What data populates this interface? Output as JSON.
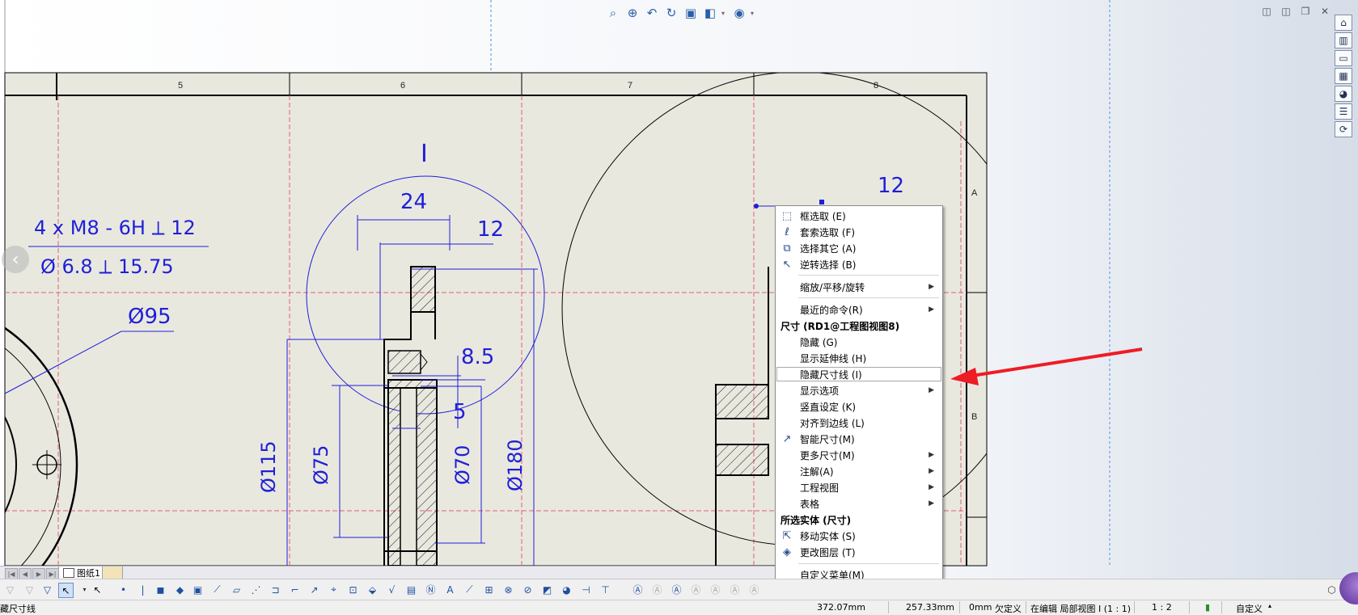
{
  "drawing": {
    "zone_numbers": [
      "5",
      "6",
      "7",
      "8"
    ],
    "zone_letters": [
      "A",
      "B"
    ],
    "detail_label": "I",
    "callout_line1": "4 x M8 - 6H ⟂ 12",
    "callout_line2": "Ø 6.8 ⟂ 15.75",
    "dim_phi95": "Ø95",
    "dim_24": "24",
    "dim_12_top": "12",
    "dim_8_5": "8.5",
    "dim_5": "5",
    "dim_phi115": "Ø115",
    "dim_phi75": "Ø75",
    "dim_phi70": "Ø70",
    "dim_phi180": "Ø180",
    "dim_12_right": "12"
  },
  "context_menu": {
    "box_select": "框选取 (E)",
    "lasso_select": "套索选取 (F)",
    "select_other": "选择其它 (A)",
    "invert_select": "逆转选择 (B)",
    "zoom_pan_rotate": "缩放/平移/旋转",
    "recent_commands": "最近的命令(R)",
    "dimension_header": "尺寸 (RD1@工程图视图8)",
    "hide": "隐藏 (G)",
    "show_extension": "显示延伸线 (H)",
    "hide_dimension_line": "隐藏尺寸线 (I)",
    "display_options": "显示选项",
    "vertical_setting": "竖直设定 (K)",
    "align_to_edge": "对齐到边线 (L)",
    "smart_dimension": "智能尺寸(M)",
    "more_dimensions": "更多尺寸(M)",
    "annotations": "注解(A)",
    "drawing_views": "工程视图",
    "tables": "表格",
    "selected_entity_header": "所选实体 (尺寸)",
    "move_entity": "移动实体 (S)",
    "change_layer": "更改图层 (T)",
    "customize_menu": "自定义菜单(M)"
  },
  "sheet_tab": {
    "label": "图纸1"
  },
  "status_bar": {
    "hint": "藏尺寸线",
    "coord_x": "372.07mm",
    "coord_y": "257.33mm",
    "coord_z": "0mm",
    "define_state": "欠定义",
    "edit_context": "在编辑 局部视图 I (1 : 1)",
    "scale": "1 : 2",
    "units": "自定义"
  },
  "colors": {
    "sheet_bg": "#e9e8df",
    "dimension_blue": "#1f1fd8",
    "centerline_pink": "#e0607a",
    "annotation_arrow": "#ee1c25"
  }
}
